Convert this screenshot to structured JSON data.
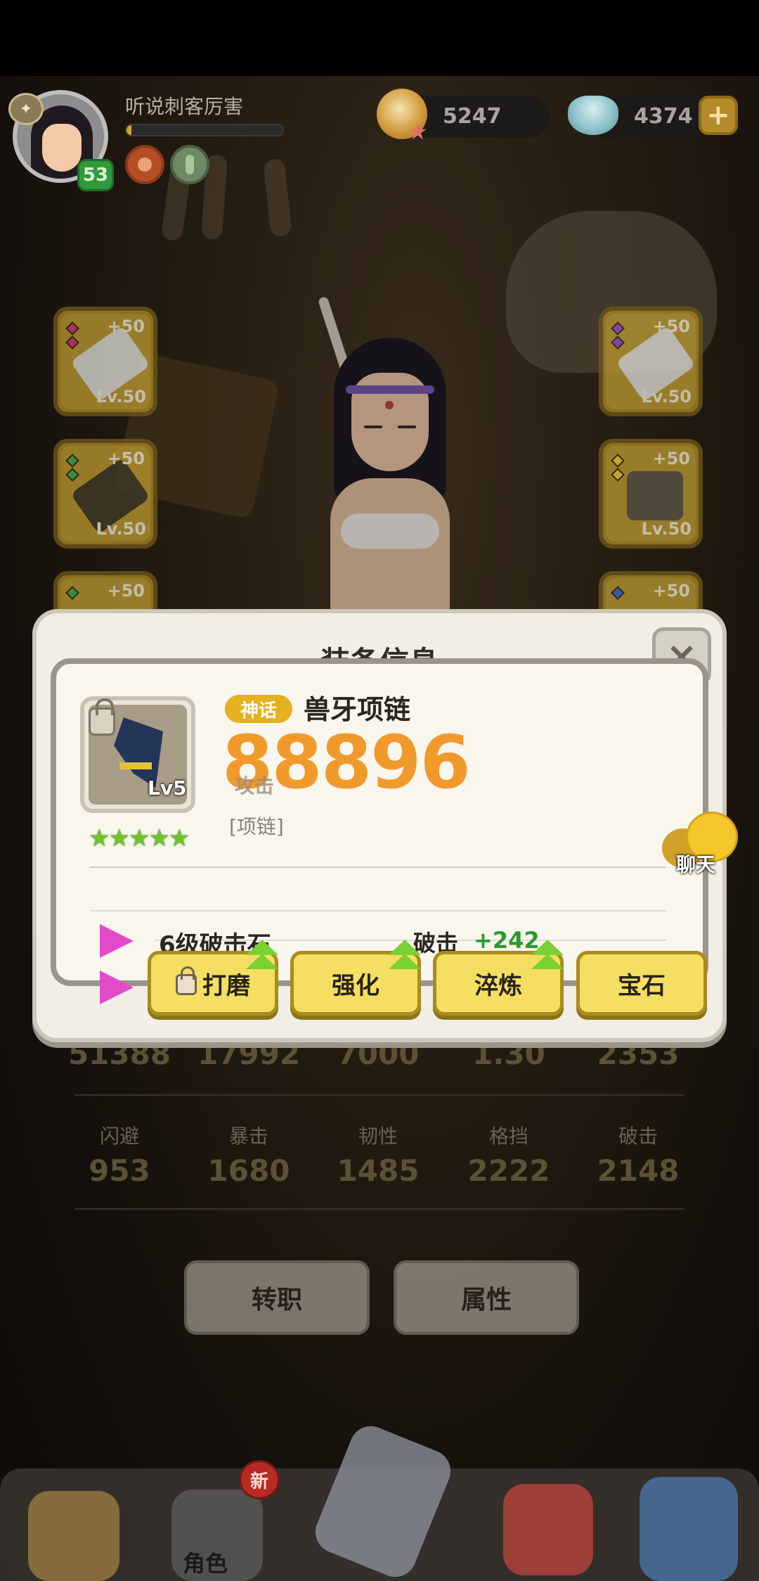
{
  "header": {
    "player_name": "听说刺客厉害",
    "level": "53",
    "xp_fraction": 0.03,
    "gold": "5247",
    "gems": "4374",
    "plus_label": "+"
  },
  "equip_slots": [
    {
      "plus": "+50",
      "level": "Lv.50"
    },
    {
      "plus": "+50",
      "level": "Lv.50"
    },
    {
      "plus": "+50",
      "level": "Lv.50"
    },
    {
      "plus": "+50",
      "level": "Lv.50"
    },
    {
      "plus": "+50"
    },
    {
      "plus": "+50"
    }
  ],
  "stats_rows": [
    {
      "labels": [],
      "values": [
        "51388",
        "17992",
        "7000",
        "1.30",
        "2353"
      ]
    },
    {
      "labels": [
        "闪避",
        "暴击",
        "韧性",
        "格挡",
        "破击"
      ],
      "values": [
        "953",
        "1680",
        "1485",
        "2222",
        "2148"
      ]
    }
  ],
  "buttons": {
    "job_change": "转职",
    "attributes": "属性"
  },
  "nav": {
    "new_badge": "新",
    "role_label": "角色"
  },
  "modal": {
    "title": "装备信息",
    "close_label": "×",
    "item": {
      "rarity": "神话",
      "name": "兽牙项链",
      "power": "88896",
      "power_label": "攻击",
      "type": "[项链]",
      "level": "Lv5",
      "stars": "★★★★★"
    },
    "gems": [
      {
        "name": "6级破击石",
        "attr": "破击",
        "value": "+242"
      }
    ],
    "actions": {
      "grind": "打磨",
      "enhance": "强化",
      "refine": "淬炼",
      "gem": "宝石"
    }
  },
  "chat_label": "聊天",
  "colors": {
    "power_orange": "#f19a2c",
    "button_yellow": "#f6de62",
    "rarity_gold": "#e6b01e",
    "bonus_green": "#2b9a2e",
    "star_green": "#6fc42e"
  }
}
